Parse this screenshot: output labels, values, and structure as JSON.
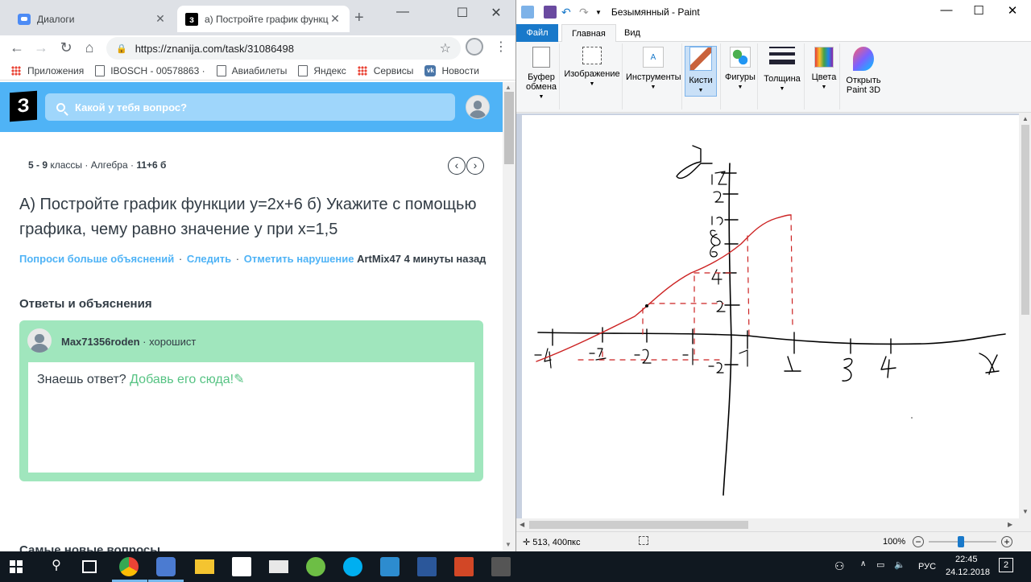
{
  "chrome": {
    "tabs": [
      {
        "title": "Диалоги"
      },
      {
        "title": "а) Постройте график функци"
      }
    ],
    "url": "https://znanija.com/task/31086498",
    "bookmarks": [
      "Приложения",
      "IBOSCH - 00578863 ·",
      "Авиабилеты",
      "Яндекс",
      "Сервисы",
      "Новости"
    ],
    "site": {
      "logo": "З",
      "search_placeholder": "Какой у тебя вопрос?",
      "crumb_grade": "5 - 9",
      "crumb_grade_suffix": "классы",
      "crumb_subject": "Алгебра",
      "crumb_points": "11+6 б",
      "question": "А) Постройте график функции y=2x+6 б) Укажите с помощью графика, чему равно значение y при x=1,5",
      "action_more": "Попроси больше объяснений",
      "action_follow": "Следить",
      "action_report": "Отметить нарушение",
      "author": "ArtMix47",
      "time_ago": "4 минуты назад",
      "answers_title": "Ответы и объяснения",
      "answer_user": "Max71356roden",
      "answer_rank": "хорошист",
      "prompt_text": "Знаешь ответ?",
      "prompt_link": "Добавь его сюда!",
      "more_title": "Самые новые вопросы"
    }
  },
  "paint": {
    "title": "Безымянный - Paint",
    "tabs": {
      "file": "Файл",
      "home": "Главная",
      "view": "Вид"
    },
    "ribbon": {
      "clipboard": "Буфер обмена",
      "image": "Изображение",
      "tools": "Инструменты",
      "brushes": "Кисти",
      "shapes": "Фигуры",
      "size": "Толщина",
      "colors": "Цвета",
      "paint3d": "Открыть Paint 3D"
    },
    "status": {
      "position": "513, 400пкс",
      "zoom": "100%"
    },
    "drawing": {
      "ink_color": "#000000",
      "graph_color": "#cc2222"
    }
  },
  "taskbar": {
    "language": "РУС",
    "time": "22:45",
    "date": "24.12.2018",
    "notifications": "2"
  }
}
